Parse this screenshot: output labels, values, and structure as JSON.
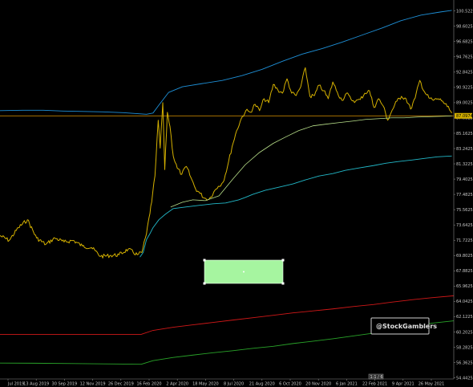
{
  "watermark": "@StockGamblers",
  "scroll_label": "1:1 / 6",
  "last_price_label": "87.0974",
  "colors": {
    "background": "#000000",
    "price": "#d4b000",
    "upper_band_outer": "#1e8fd6",
    "middle_band": "#b9e08a",
    "lower_band": "#22b8c8",
    "red_line": "#d01818",
    "green_line": "#29a329",
    "horizontal_line": "#c08000",
    "highlight_box": "#a6f5a0"
  },
  "chart_data": {
    "type": "line",
    "title": "",
    "xlabel": "",
    "ylabel": "",
    "ylim": [
      54.3,
      101.9
    ],
    "x_range": [
      "2019-07-11",
      "2021-06-04"
    ],
    "x_ticks": [
      "Jul 2019",
      "13 Aug 2019",
      "30 Sep 2019",
      "12 Nov 2019",
      "26 Dec 2019",
      "16 Feb 2020",
      "2 Apr 2020",
      "18 May 2020",
      "8 Jul 2020",
      "21 Aug 2020",
      "6 Oct 2020",
      "20 Nov 2020",
      "6 Jan 2021",
      "22 Feb 2021",
      "9 Apr 2021",
      "26 May 2021"
    ],
    "y_ticks": [
      100.5225,
      98.6025,
      96.6825,
      94.7625,
      92.8425,
      90.9225,
      89.0025,
      87.0825,
      85.1625,
      83.2425,
      81.3225,
      79.4025,
      77.4825,
      75.5625,
      73.6425,
      71.7225,
      69.8025,
      67.8825,
      65.9625,
      64.0425,
      62.1225,
      60.2025,
      58.2825,
      56.3625,
      54.4425
    ],
    "grid": false,
    "horizontal_line": 87.35,
    "series": [
      {
        "role": "price",
        "x": [
          "2019-07-11",
          "2019-07-25",
          "2019-08-08",
          "2019-08-22",
          "2019-09-05",
          "2019-09-19",
          "2019-10-03",
          "2019-10-17",
          "2019-10-31",
          "2019-11-14",
          "2019-11-28",
          "2019-12-12",
          "2019-12-26",
          "2020-01-09",
          "2020-01-23",
          "2020-02-06",
          "2020-02-13",
          "2020-02-20",
          "2020-02-24",
          "2020-02-28",
          "2020-03-04",
          "2020-03-09",
          "2020-03-12",
          "2020-03-16",
          "2020-03-19",
          "2020-03-23",
          "2020-03-27",
          "2020-04-01",
          "2020-04-07",
          "2020-04-14",
          "2020-04-21",
          "2020-04-28",
          "2020-05-05",
          "2020-05-12",
          "2020-05-19",
          "2020-05-26",
          "2020-06-02",
          "2020-06-09",
          "2020-06-16",
          "2020-06-23",
          "2020-06-30",
          "2020-07-07",
          "2020-07-14",
          "2020-07-21",
          "2020-07-28",
          "2020-08-04",
          "2020-08-11",
          "2020-08-18",
          "2020-08-25",
          "2020-09-01",
          "2020-09-08",
          "2020-09-15",
          "2020-09-22",
          "2020-09-29",
          "2020-10-06",
          "2020-10-13",
          "2020-10-20",
          "2020-10-27",
          "2020-11-03",
          "2020-11-10",
          "2020-11-17",
          "2020-11-24",
          "2020-12-01",
          "2020-12-08",
          "2020-12-15",
          "2020-12-22",
          "2020-12-29",
          "2021-01-05",
          "2021-01-12",
          "2021-01-19",
          "2021-01-26",
          "2021-02-02",
          "2021-02-09",
          "2021-02-16",
          "2021-02-23",
          "2021-03-02",
          "2021-03-09",
          "2021-03-16",
          "2021-03-23",
          "2021-03-30",
          "2021-04-06",
          "2021-04-13",
          "2021-04-20",
          "2021-04-27",
          "2021-05-04",
          "2021-05-11",
          "2021-05-18",
          "2021-05-25",
          "2021-06-01"
        ],
        "values": [
          72.3,
          71.7,
          73.3,
          74.3,
          72.0,
          71.2,
          72.0,
          71.5,
          71.7,
          71.0,
          70.8,
          69.7,
          69.8,
          69.9,
          70.6,
          69.9,
          70.2,
          72.5,
          74.6,
          76.5,
          79.8,
          86.8,
          83.3,
          89.0,
          80.6,
          87.8,
          86.0,
          82.3,
          80.8,
          80.0,
          81.0,
          79.6,
          78.2,
          77.6,
          77.0,
          76.9,
          77.8,
          78.5,
          79.0,
          81.0,
          83.5,
          85.5,
          87.0,
          88.0,
          87.8,
          88.8,
          88.0,
          89.5,
          89.0,
          91.3,
          90.6,
          90.2,
          92.0,
          90.2,
          89.9,
          91.0,
          93.4,
          89.8,
          89.9,
          91.2,
          90.5,
          89.5,
          91.6,
          90.3,
          89.3,
          90.2,
          89.4,
          89.2,
          89.4,
          90.2,
          90.5,
          88.4,
          89.5,
          88.6,
          86.8,
          88.1,
          89.2,
          89.8,
          89.5,
          88.2,
          89.6,
          91.8,
          90.4,
          89.6,
          89.3,
          89.5,
          89.2,
          88.5,
          87.7
        ]
      },
      {
        "role": "upper-band",
        "x": [
          "2019-07-11",
          "2019-08-15",
          "2019-09-15",
          "2019-10-15",
          "2019-11-15",
          "2019-12-15",
          "2020-01-15",
          "2020-02-20",
          "2020-03-01",
          "2020-03-10",
          "2020-03-25",
          "2020-04-15",
          "2020-05-15",
          "2020-06-15",
          "2020-07-15",
          "2020-08-15",
          "2020-09-15",
          "2020-10-15",
          "2020-11-15",
          "2020-12-15",
          "2021-01-15",
          "2021-02-15",
          "2021-03-15",
          "2021-04-15",
          "2021-05-15",
          "2021-06-01"
        ],
        "values": [
          88.0,
          88.05,
          88.05,
          87.95,
          87.9,
          87.85,
          87.75,
          87.55,
          87.7,
          88.7,
          90.3,
          91.0,
          91.4,
          91.8,
          92.4,
          93.2,
          94.2,
          95.1,
          95.8,
          96.6,
          97.5,
          98.4,
          99.3,
          100.0,
          100.4,
          100.6
        ]
      },
      {
        "role": "mid-band",
        "x": [
          "2020-03-28",
          "2020-04-15",
          "2020-05-01",
          "2020-05-20",
          "2020-06-10",
          "2020-07-01",
          "2020-07-20",
          "2020-08-10",
          "2020-09-01",
          "2020-09-20",
          "2020-10-10",
          "2020-11-01",
          "2020-11-20",
          "2020-12-10",
          "2021-01-01",
          "2021-01-20",
          "2021-02-10",
          "2021-03-01",
          "2021-03-20",
          "2021-04-10",
          "2021-05-01",
          "2021-05-20",
          "2021-06-01"
        ],
        "values": [
          75.9,
          76.5,
          76.8,
          76.7,
          77.3,
          79.4,
          81.2,
          82.7,
          83.9,
          84.7,
          85.5,
          86.1,
          86.3,
          86.5,
          86.7,
          86.9,
          87.0,
          87.1,
          87.1,
          87.2,
          87.25,
          87.3,
          87.35
        ]
      },
      {
        "role": "lower-band",
        "x": [
          "2020-02-10",
          "2020-02-15",
          "2020-02-20",
          "2020-02-25",
          "2020-03-01",
          "2020-03-10",
          "2020-03-20",
          "2020-04-01",
          "2020-04-20",
          "2020-05-10",
          "2020-06-01",
          "2020-06-20",
          "2020-07-10",
          "2020-07-20",
          "2020-08-01",
          "2020-08-20",
          "2020-09-10",
          "2020-10-01",
          "2020-10-20",
          "2020-11-10",
          "2020-12-01",
          "2020-12-20",
          "2021-01-10",
          "2021-02-01",
          "2021-02-20",
          "2021-03-10",
          "2021-04-01",
          "2021-04-20",
          "2021-05-10",
          "2021-06-01"
        ],
        "values": [
          69.6,
          70.2,
          71.8,
          72.5,
          73.3,
          74.3,
          75.0,
          75.7,
          75.9,
          76.1,
          76.3,
          76.4,
          76.8,
          77.1,
          77.5,
          78.0,
          78.4,
          78.8,
          79.3,
          79.8,
          80.1,
          80.5,
          80.8,
          81.1,
          81.4,
          81.6,
          81.8,
          82.0,
          82.2,
          82.3
        ]
      },
      {
        "role": "red-line",
        "x": [
          "2019-07-11",
          "2019-09-01",
          "2019-11-01",
          "2020-01-01",
          "2020-02-12",
          "2020-03-01",
          "2020-04-01",
          "2020-05-01",
          "2020-06-01",
          "2020-07-01",
          "2020-08-01",
          "2020-09-01",
          "2020-10-01",
          "2020-11-01",
          "2020-12-01",
          "2021-01-01",
          "2021-02-01",
          "2021-03-01",
          "2021-04-01",
          "2021-05-01",
          "2021-06-04"
        ],
        "values": [
          59.9,
          59.9,
          59.9,
          59.9,
          59.9,
          60.4,
          60.8,
          61.1,
          61.4,
          61.7,
          62.0,
          62.3,
          62.6,
          62.85,
          63.1,
          63.4,
          63.65,
          63.95,
          64.25,
          64.5,
          64.75
        ]
      },
      {
        "role": "green-line",
        "x": [
          "2019-07-11",
          "2019-09-01",
          "2019-11-01",
          "2020-01-01",
          "2020-02-12",
          "2020-03-01",
          "2020-04-01",
          "2020-05-01",
          "2020-06-01",
          "2020-07-01",
          "2020-08-01",
          "2020-09-01",
          "2020-10-01",
          "2020-11-01",
          "2020-12-01",
          "2021-01-01",
          "2021-02-01",
          "2021-03-01",
          "2021-04-01",
          "2021-05-01",
          "2021-06-04"
        ],
        "values": [
          56.3,
          56.28,
          56.23,
          56.18,
          56.15,
          56.6,
          57.0,
          57.3,
          57.6,
          57.85,
          58.15,
          58.4,
          58.75,
          59.05,
          59.35,
          59.7,
          60.05,
          60.4,
          60.8,
          61.3,
          61.6
        ]
      }
    ]
  }
}
